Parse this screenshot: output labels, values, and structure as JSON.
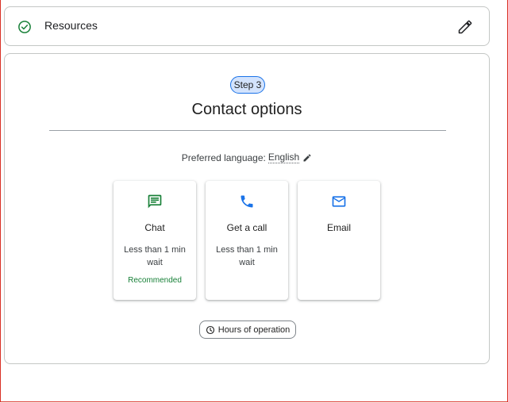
{
  "resources": {
    "title": "Resources",
    "status_color": "#188038"
  },
  "contact": {
    "step_label": "Step 3",
    "title": "Contact options",
    "preferred_language_label": "Preferred language:",
    "preferred_language_value": "English",
    "options": [
      {
        "label": "Chat",
        "wait": "Less than 1 min wait",
        "badge": "Recommended",
        "icon": "chat-icon",
        "color": "#188038"
      },
      {
        "label": "Get a call",
        "wait": "Less than 1 min wait",
        "icon": "phone-icon",
        "color": "#1a73e8"
      },
      {
        "label": "Email",
        "icon": "mail-icon",
        "color": "#1a73e8"
      }
    ],
    "hours_button": "Hours of operation"
  }
}
